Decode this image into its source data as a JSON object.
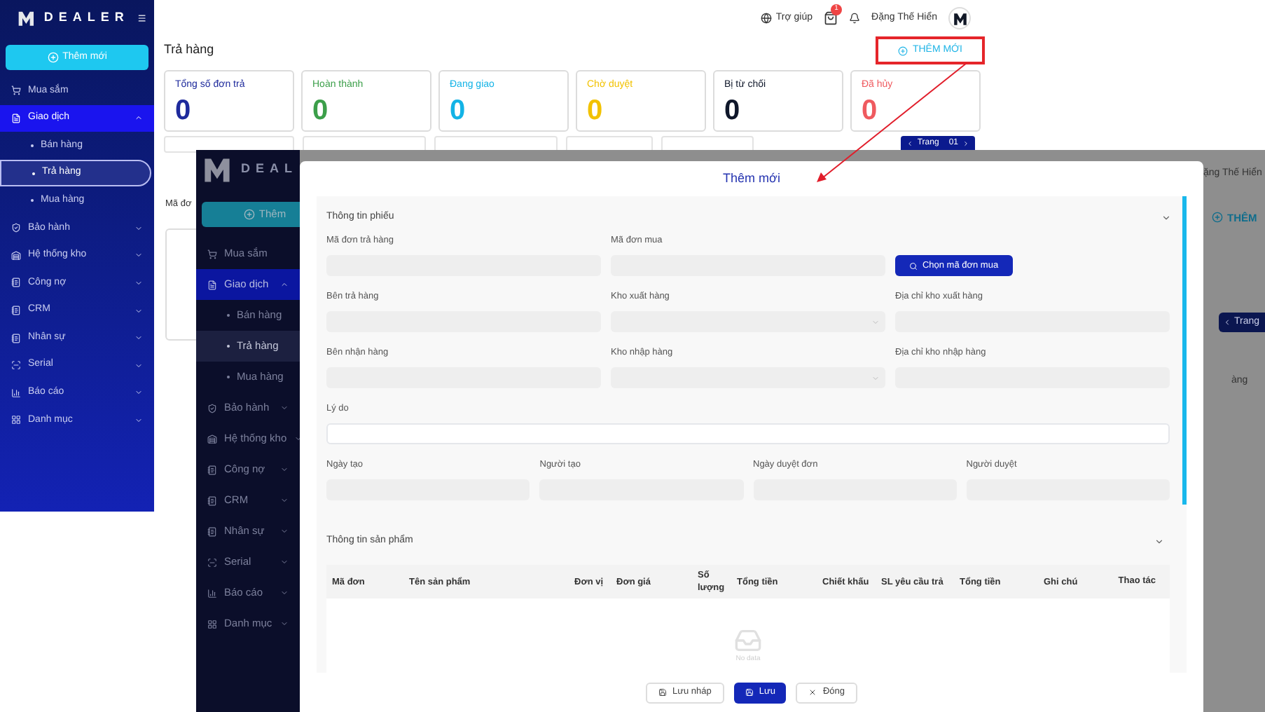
{
  "screen_1": {
    "sidebar": {
      "logo": "DEALER",
      "add_button": "Thêm mới",
      "items": [
        {
          "label": "Mua sắm",
          "selected": false
        },
        {
          "label": "Giao dịch",
          "selected": true,
          "expanded": true,
          "children": [
            {
              "label": "Bán hàng",
              "selected": false
            },
            {
              "label": "Trả hàng",
              "selected": true
            },
            {
              "label": "Mua hàng",
              "selected": false
            }
          ]
        },
        {
          "label": "Bảo hành",
          "selected": false,
          "expanded": false
        },
        {
          "label": "Hệ thống kho",
          "selected": false,
          "expanded": false
        },
        {
          "label": "Công nợ",
          "selected": false,
          "expanded": false
        },
        {
          "label": "CRM",
          "selected": false,
          "expanded": false
        },
        {
          "label": "Nhân sự",
          "selected": false,
          "expanded": false
        },
        {
          "label": "Serial",
          "selected": false,
          "expanded": false
        },
        {
          "label": "Báo cáo",
          "selected": false,
          "expanded": false
        },
        {
          "label": "Danh mục",
          "selected": false,
          "expanded": false
        }
      ]
    },
    "header": {
      "help": "Trợ giúp",
      "cart_badge": "1",
      "user": "Đặng Thế Hiển"
    },
    "title": "Trả hàng",
    "add_button": "THÊM MỚI",
    "stats": [
      {
        "label": "Tổng số đơn trả",
        "value": "0",
        "color": "#1e2a9c"
      },
      {
        "label": "Hoàn thành",
        "value": "0",
        "color": "#3c9f4a"
      },
      {
        "label": "Đang giao",
        "value": "0",
        "color": "#13b3e6"
      },
      {
        "label": "Chờ duyệt",
        "value": "0",
        "color": "#f2c200"
      },
      {
        "label": "Bị từ chối",
        "value": "0",
        "color": "#0f172a"
      },
      {
        "label": "Đã hủy",
        "value": "0",
        "color": "#ef5a5f"
      }
    ],
    "pagination": {
      "label": "Trang",
      "page": "01"
    },
    "table": {
      "column_1": "Mã đơ"
    }
  },
  "screen_2": {
    "sidebar": {
      "logo": "DEAL",
      "add_button": "Thêm",
      "items": [
        {
          "label": "Mua sắm",
          "selected": false
        },
        {
          "label": "Giao dịch",
          "selected": true,
          "expanded": true,
          "children": [
            {
              "label": "Bán hàng",
              "selected": false
            },
            {
              "label": "Trả hàng",
              "selected": true
            },
            {
              "label": "Mua hàng",
              "selected": false
            }
          ]
        },
        {
          "label": "Bảo hành",
          "selected": false,
          "expanded": false
        },
        {
          "label": "Hệ thống kho",
          "selected": false,
          "expanded": false
        },
        {
          "label": "Công nợ",
          "selected": false,
          "expanded": false
        },
        {
          "label": "CRM",
          "selected": false,
          "expanded": false
        },
        {
          "label": "Nhân sự",
          "selected": false,
          "expanded": false
        },
        {
          "label": "Serial",
          "selected": false,
          "expanded": false
        },
        {
          "label": "Báo cáo",
          "selected": false,
          "expanded": false
        },
        {
          "label": "Danh mục",
          "selected": false,
          "expanded": false
        }
      ]
    },
    "header_user": "ặng Thế Hiển",
    "add_button": "THÊM",
    "pagination_label": "Trang",
    "row_text": "àng",
    "modal": {
      "title": "Thêm mới",
      "section_1": {
        "title": "Thông tin phiếu",
        "expanded": true,
        "rows": [
          [
            {
              "label": "Mã đơn trả hàng",
              "kind": "input",
              "disabled": true
            },
            {
              "label": "Mã đơn mua",
              "kind": "input",
              "disabled": true
            },
            {
              "label": "Chọn mã đơn mua",
              "kind": "button"
            }
          ],
          [
            {
              "label": "Bên trả hàng",
              "kind": "input",
              "disabled": true
            },
            {
              "label": "Kho xuất hàng",
              "kind": "select",
              "disabled": true
            },
            {
              "label": "Địa chỉ kho xuất hàng",
              "kind": "input",
              "disabled": true
            }
          ],
          [
            {
              "label": "Bên nhận hàng",
              "kind": "input",
              "disabled": true
            },
            {
              "label": "Kho nhập hàng",
              "kind": "select",
              "disabled": true
            },
            {
              "label": "Địa chỉ kho nhập hàng",
              "kind": "input",
              "disabled": true
            }
          ],
          [
            {
              "label": "Lý do",
              "kind": "input",
              "disabled": false
            }
          ],
          [
            {
              "label": "Ngày tạo",
              "kind": "input",
              "disabled": true
            },
            {
              "label": "Người tạo",
              "kind": "input",
              "disabled": true
            },
            {
              "label": "Ngày duyệt đơn",
              "kind": "input",
              "disabled": true
            },
            {
              "label": "Người duyệt",
              "kind": "input",
              "disabled": true
            }
          ]
        ]
      },
      "section_2": {
        "title": "Thông tin sản phẩm",
        "expanded": true,
        "columns": [
          "Mã đơn",
          "Tên sản phẩm",
          "Đơn vị",
          "Đơn giá",
          "Số lượng",
          "Tổng tiền",
          "Chiết khấu",
          "SL yêu cầu trả",
          "Tổng tiền",
          "Ghi chú",
          "Thao tác"
        ],
        "empty_text": "No data"
      },
      "buttons": [
        {
          "label": "Lưu nháp",
          "kind": "draft"
        },
        {
          "label": "Lưu",
          "kind": "save"
        },
        {
          "label": "Đóng",
          "kind": "close"
        }
      ]
    }
  }
}
